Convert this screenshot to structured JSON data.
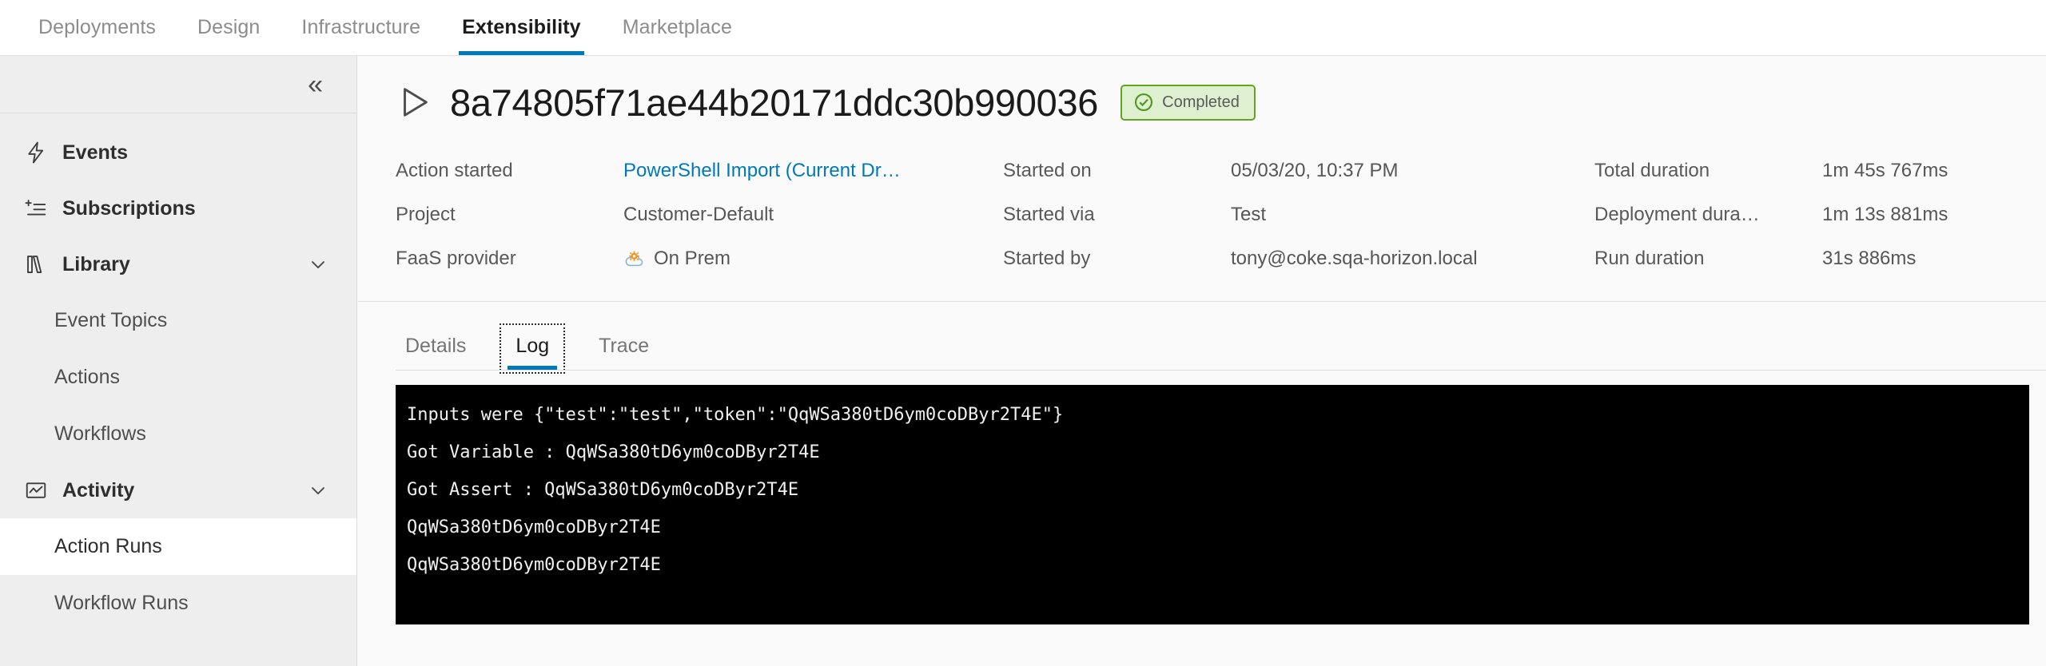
{
  "theme": {
    "accent": "#0079b8",
    "status_green_border": "#62a420",
    "status_green_bg": "#dff0d0",
    "link_blue": "#0079b8"
  },
  "topnav": {
    "items": [
      {
        "label": "Deployments",
        "active": false
      },
      {
        "label": "Design",
        "active": false
      },
      {
        "label": "Infrastructure",
        "active": false
      },
      {
        "label": "Extensibility",
        "active": true
      },
      {
        "label": "Marketplace",
        "active": false
      }
    ]
  },
  "sidebar": {
    "collapse_glyph": "«",
    "items": [
      {
        "label": "Events",
        "icon": "lightning-bolt-icon",
        "level": "top",
        "caret": false
      },
      {
        "label": "Subscriptions",
        "icon": "subscription-list-icon",
        "level": "top",
        "caret": false
      },
      {
        "label": "Library",
        "icon": "book-icon",
        "level": "top",
        "caret": true
      },
      {
        "label": "Event Topics",
        "icon": "",
        "level": "child",
        "caret": false,
        "selected": false
      },
      {
        "label": "Actions",
        "icon": "",
        "level": "child",
        "caret": false,
        "selected": false
      },
      {
        "label": "Workflows",
        "icon": "",
        "level": "child",
        "caret": false,
        "selected": false
      },
      {
        "label": "Activity",
        "icon": "activity-chart-icon",
        "level": "top",
        "caret": true
      },
      {
        "label": "Action Runs",
        "icon": "",
        "level": "child",
        "caret": false,
        "selected": true
      },
      {
        "label": "Workflow Runs",
        "icon": "",
        "level": "child",
        "caret": false,
        "selected": false
      }
    ]
  },
  "run": {
    "id": "8a74805f71ae44b20171ddc30b990036",
    "status_label": "Completed",
    "meta": {
      "col1": [
        {
          "label": "Action started",
          "value": "PowerShell Import (Current Dr…",
          "is_link": true
        },
        {
          "label": "Project",
          "value": "Customer-Default",
          "is_link": false
        },
        {
          "label": "FaaS provider",
          "value": "On Prem",
          "is_link": false,
          "icon": "on-prem-cloud-icon"
        }
      ],
      "col2": [
        {
          "label": "Started on",
          "value": "05/03/20, 10:37 PM"
        },
        {
          "label": "Started via",
          "value": "Test"
        },
        {
          "label": "Started by",
          "value": "tony@coke.sqa-horizon.local"
        }
      ],
      "col3": [
        {
          "label": "Total duration",
          "value": "1m 45s 767ms"
        },
        {
          "label": "Deployment dura…",
          "value": "1m 13s 881ms"
        },
        {
          "label": "Run duration",
          "value": "31s 886ms"
        }
      ]
    }
  },
  "tabs": [
    {
      "label": "Details",
      "active": false
    },
    {
      "label": "Log",
      "active": true
    },
    {
      "label": "Trace",
      "active": false
    }
  ],
  "log": {
    "lines": [
      "Inputs were {\"test\":\"test\",\"token\":\"QqWSa380tD6ym0coDByr2T4E\"}",
      "Got Variable : QqWSa380tD6ym0coDByr2T4E",
      "Got Assert : QqWSa380tD6ym0coDByr2T4E",
      "QqWSa380tD6ym0coDByr2T4E",
      "QqWSa380tD6ym0coDByr2T4E"
    ]
  }
}
